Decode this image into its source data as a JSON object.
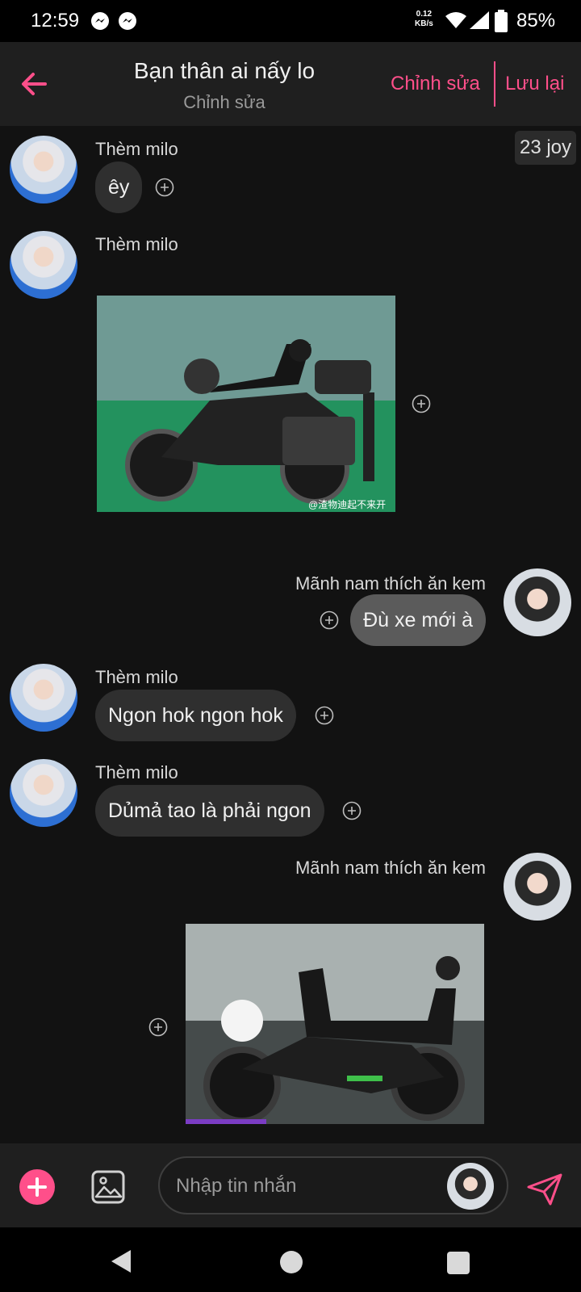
{
  "status_bar": {
    "time": "12:59",
    "net_speed_value": "0.12",
    "net_speed_unit": "KB/s",
    "battery": "85%",
    "icons": [
      "messenger-icon",
      "messenger-icon",
      "wifi-icon",
      "signal-icon",
      "battery-icon"
    ]
  },
  "header": {
    "title": "Bạn thân ai nấy lo",
    "subtitle": "Chỉnh sửa",
    "edit_label": "Chỉnh sửa",
    "save_label": "Lưu lại",
    "accent_color": "#ff4f8a"
  },
  "chat": {
    "timestamp_badge": "23 joy",
    "messages": [
      {
        "sender": "Thèm milo",
        "side": "left",
        "type": "text",
        "text": "êy"
      },
      {
        "sender": "Thèm milo",
        "side": "left",
        "type": "image",
        "caption": "@渣物迪起不来开"
      },
      {
        "sender": "Mãnh nam thích ăn kem",
        "side": "right",
        "type": "text",
        "text": "Đù xe mới à"
      },
      {
        "sender": "Thèm milo",
        "side": "left",
        "type": "text",
        "text": "Ngon hok ngon hok"
      },
      {
        "sender": "Thèm milo",
        "side": "left",
        "type": "text",
        "text": "Dủmả tao là phải ngon"
      },
      {
        "sender": "Mãnh nam thích ăn kem",
        "side": "right",
        "type": "image"
      }
    ]
  },
  "composer": {
    "placeholder": "Nhập tin nhắn"
  }
}
